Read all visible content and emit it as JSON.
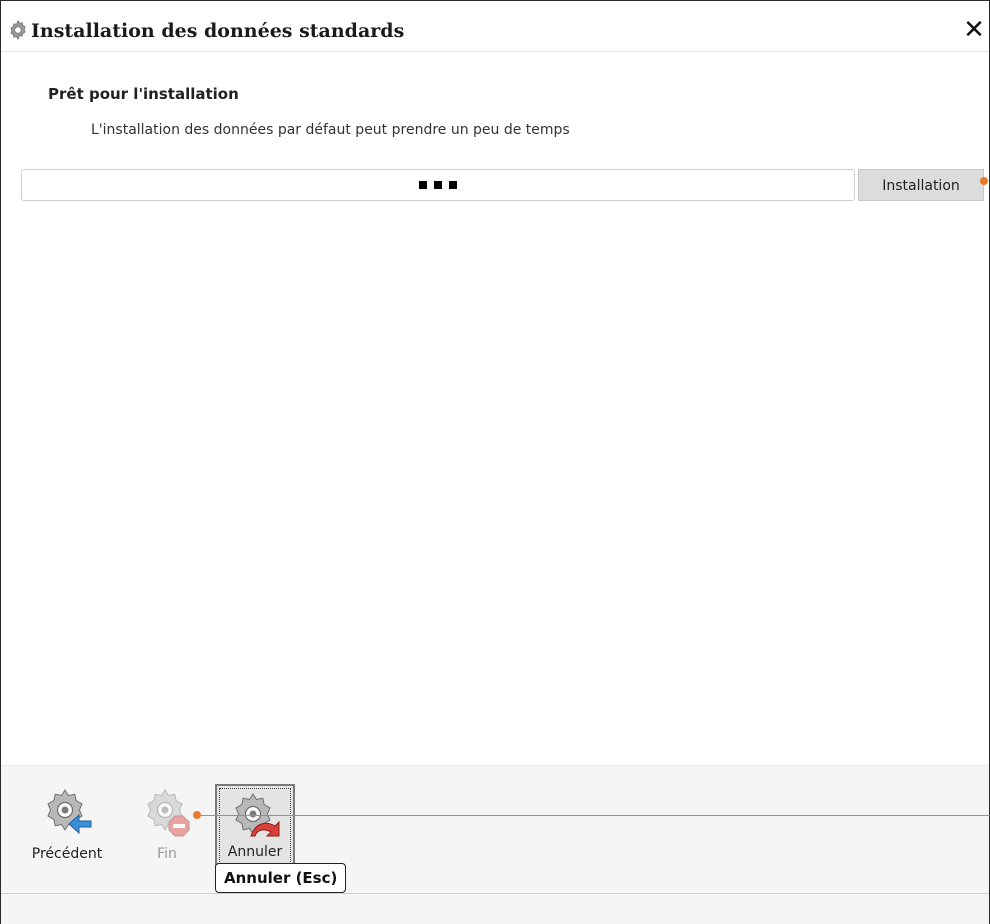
{
  "window": {
    "title": "Installation des données standards",
    "close_label": "✕"
  },
  "content": {
    "heading": "Prêt pour l'installation",
    "description": "L'installation des données par défaut peut prendre un peu de temps",
    "install_button_label": "Installation"
  },
  "footer": {
    "previous_label": "Précédent",
    "finish_label": "Fin",
    "cancel_label": "Annuler",
    "tooltip": "Annuler (Esc)"
  },
  "colors": {
    "accent_marker": "#e8792b",
    "gear_blue": "#3a8ed8",
    "gear_red": "#d9403a"
  },
  "icons": {
    "title": "gear-icon",
    "previous": "gear-arrow-left-icon",
    "finish": "gear-stop-icon",
    "cancel": "gear-cancel-icon"
  }
}
